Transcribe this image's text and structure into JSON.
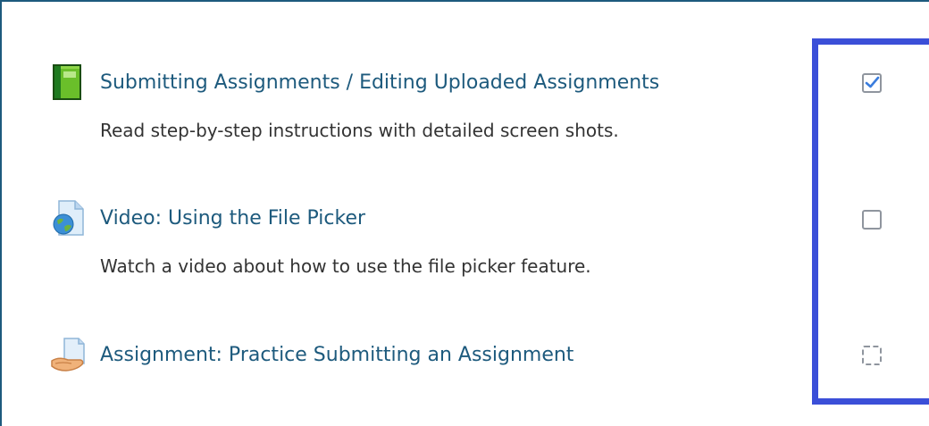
{
  "activities": [
    {
      "icon": "book-icon",
      "title": "Submitting Assignments / Editing Uploaded Assignments",
      "description": "Read step-by-step instructions with detailed screen shots.",
      "completion": "checked"
    },
    {
      "icon": "url-globe-icon",
      "title": "Video: Using the File Picker",
      "description": "Watch a video about how to use the file picker feature.",
      "completion": "unchecked"
    },
    {
      "icon": "assignment-hand-icon",
      "title": "Assignment: Practice Submitting an Assignment",
      "description": "",
      "completion": "automatic"
    }
  ],
  "colors": {
    "link": "#1d5a7d",
    "highlight_border": "#3b4fd8",
    "checkbox": "#8f959e",
    "check_mark": "#3b7ddd"
  }
}
